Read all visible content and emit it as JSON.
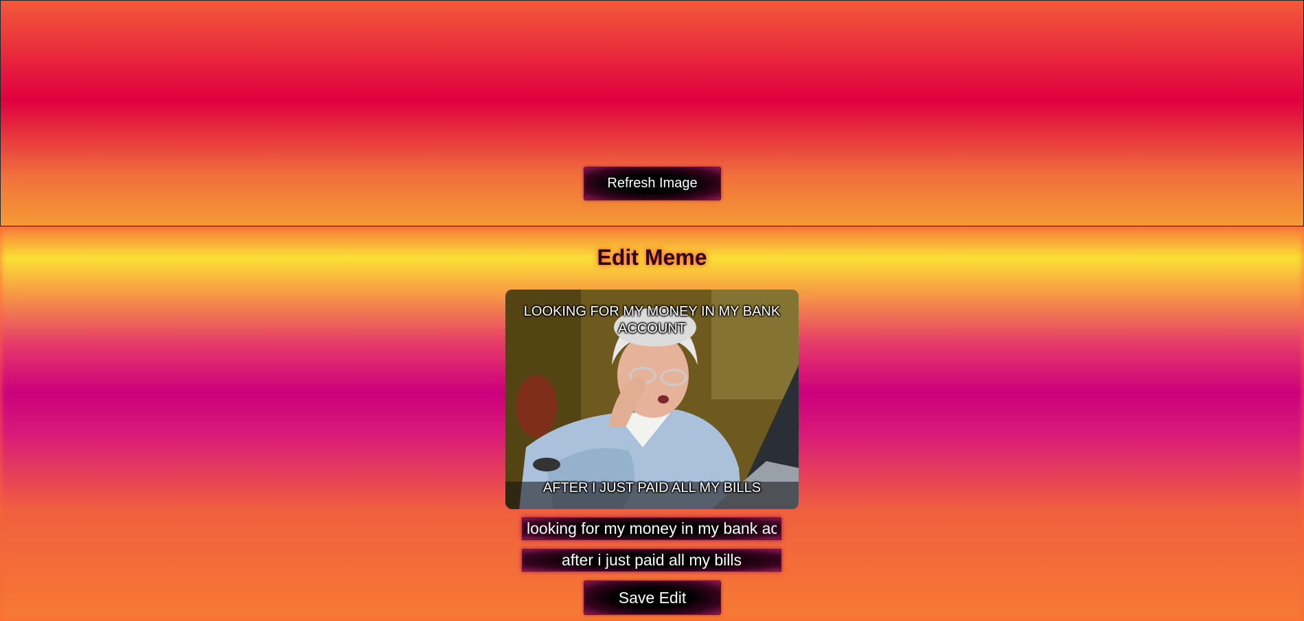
{
  "refresh": {
    "label": "Refresh Image"
  },
  "editor": {
    "title": "Edit Meme",
    "meme": {
      "image_icon": "grandma-laptop-photo",
      "top_text": "LOOKING FOR MY MONEY IN MY BANK ACCOUNT",
      "bottom_text": "AFTER I JUST PAID ALL MY BILLS"
    },
    "top_caption_value": "looking for my money in my bank account",
    "bottom_caption_value": "after i just paid all my bills",
    "save_label": "Save Edit"
  },
  "colors": {
    "button_background": "#000000",
    "button_border": "#6b0a3c",
    "title_color": "#2a0814"
  }
}
